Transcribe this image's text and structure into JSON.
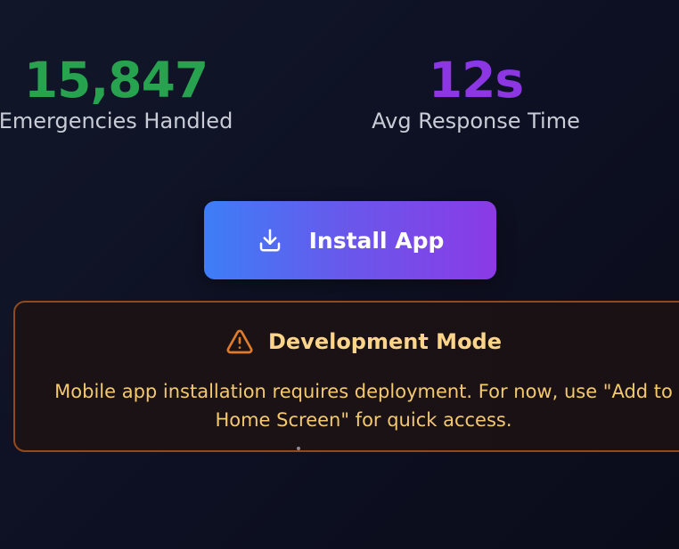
{
  "stats": [
    {
      "value": "15,847",
      "label": "Emergencies Handled",
      "color": "#27a24f"
    },
    {
      "value": "12s",
      "label": "Avg Response Time",
      "color": "#8c36e4"
    }
  ],
  "install_button": {
    "label": "Install App",
    "icon": "download-icon"
  },
  "dev_notice": {
    "icon": "warning-triangle-icon",
    "title": "Development Mode",
    "message_line1": "Mobile app installation requires deployment. For now, use \"Add to",
    "message_line2": "Home Screen\" for quick access."
  },
  "colors": {
    "accent_green": "#27a24f",
    "accent_purple": "#8c36e4",
    "button_gradient_start": "#3d7ef7",
    "button_gradient_end": "#8b3ae6",
    "warning_border": "#8f4a1f",
    "warning_text": "#f3c86f",
    "warning_icon": "#e07b2a"
  }
}
